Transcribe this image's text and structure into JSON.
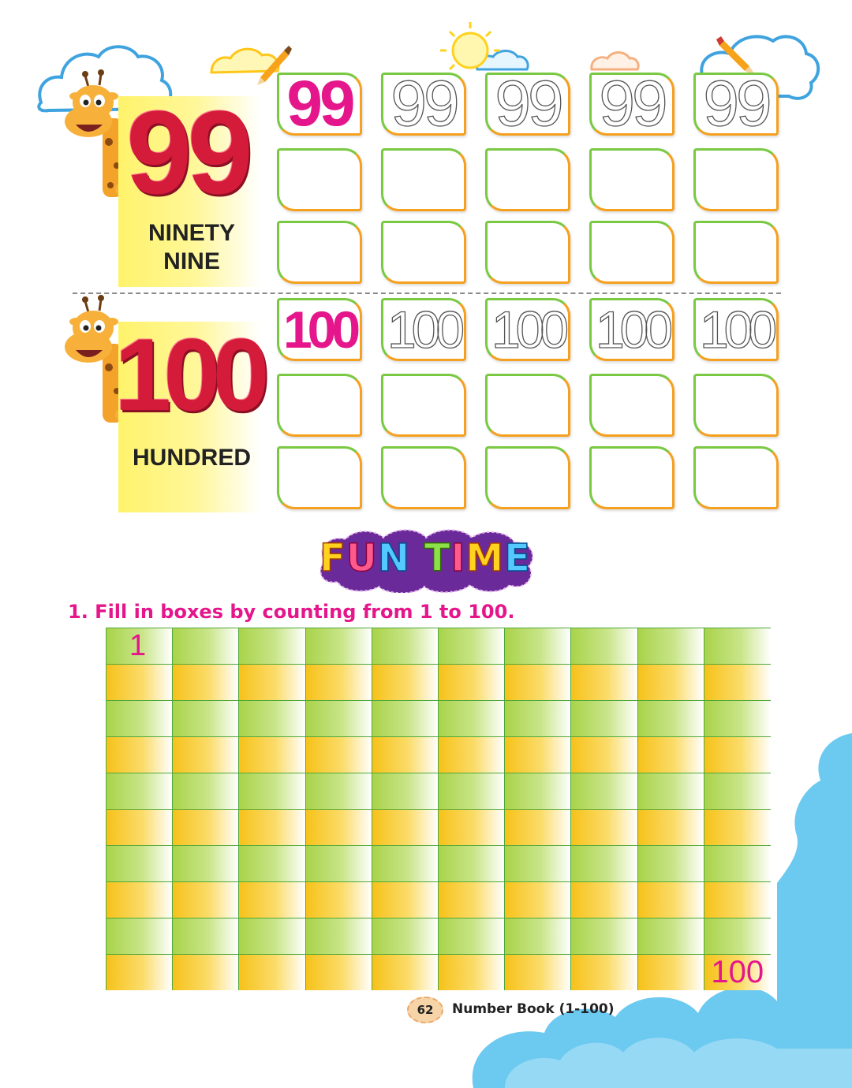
{
  "sections": [
    {
      "number": "99",
      "word": "NINETY NINE",
      "model": "99",
      "trace": [
        "99",
        "99",
        "99",
        "99"
      ]
    },
    {
      "number": "100",
      "word": "HUNDRED",
      "model": "100",
      "trace": [
        "100",
        "100",
        "100",
        "100"
      ]
    }
  ],
  "fun_time": {
    "letters": [
      "F",
      "U",
      "N",
      " ",
      "T",
      "I",
      "M",
      "E"
    ]
  },
  "activity": {
    "instruction": "1.  Fill in boxes by counting from 1 to 100.",
    "first": "1",
    "last": "100",
    "rows": 10,
    "cols": 10
  },
  "footer": {
    "page_number": "62",
    "book_title": "Number Book (1-100)"
  },
  "colors": {
    "accent_pink": "#e5158b",
    "big_number_red": "#d41c3a",
    "box_green": "#7ac943",
    "box_orange": "#f5a01e",
    "grid_green": "#a9d34a",
    "grid_yellow": "#f6c21a",
    "sky_blue": "#6cc9f0"
  },
  "icons": [
    "giraffe-icon",
    "sun-icon",
    "cloud-icon",
    "pencil-icon"
  ]
}
